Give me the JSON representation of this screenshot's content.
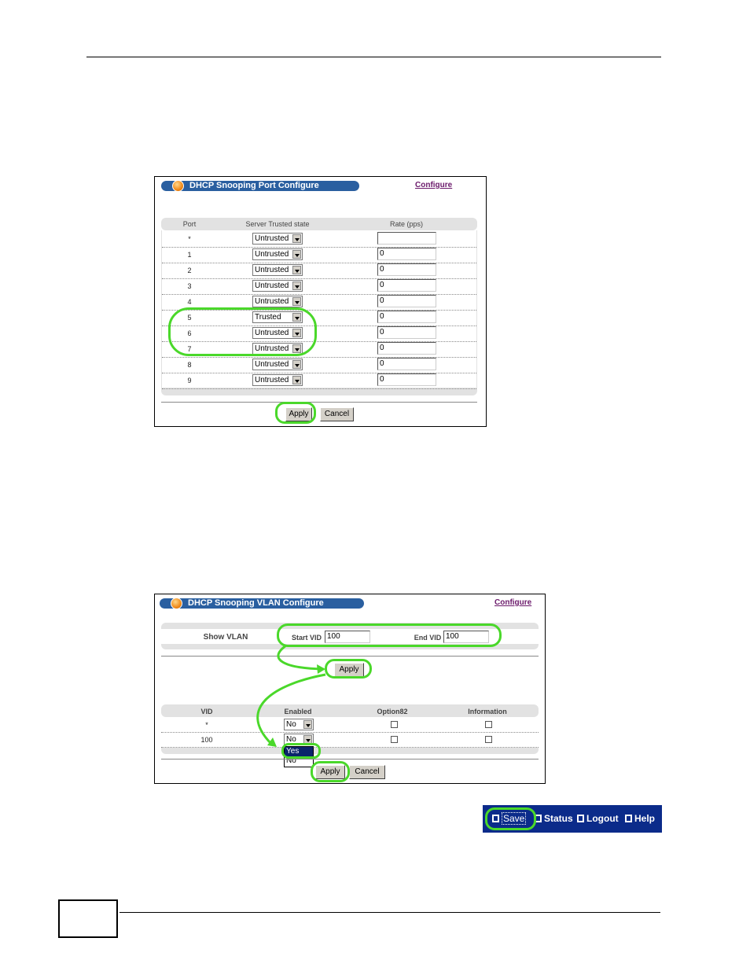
{
  "panel1": {
    "title": "DHCP Snooping Port Configure",
    "configure_link": "Configure",
    "headers": {
      "port": "Port",
      "state": "Server Trusted state",
      "rate": "Rate (pps)"
    },
    "rows": [
      {
        "port": "*",
        "state": "Untrusted",
        "rate": ""
      },
      {
        "port": "1",
        "state": "Untrusted",
        "rate": "0"
      },
      {
        "port": "2",
        "state": "Untrusted",
        "rate": "0"
      },
      {
        "port": "3",
        "state": "Untrusted",
        "rate": "0"
      },
      {
        "port": "4",
        "state": "Untrusted",
        "rate": "0"
      },
      {
        "port": "5",
        "state": "Trusted",
        "rate": "0"
      },
      {
        "port": "6",
        "state": "Untrusted",
        "rate": "0"
      },
      {
        "port": "7",
        "state": "Untrusted",
        "rate": "0"
      },
      {
        "port": "8",
        "state": "Untrusted",
        "rate": "0"
      },
      {
        "port": "9",
        "state": "Untrusted",
        "rate": "0"
      }
    ],
    "apply": "Apply",
    "cancel": "Cancel"
  },
  "panel2": {
    "title": "DHCP Snooping VLAN Configure",
    "configure_link": "Configure",
    "show_vlan": "Show VLAN",
    "start_vid_label": "Start VID",
    "start_vid_value": "100",
    "end_vid_label": "End VID",
    "end_vid_value": "100",
    "apply_top": "Apply",
    "headers": {
      "vid": "VID",
      "enabled": "Enabled",
      "option82": "Option82",
      "information": "Information"
    },
    "rows": [
      {
        "vid": "*",
        "enabled": "No",
        "option82": false,
        "information": false
      },
      {
        "vid": "100",
        "enabled": "No",
        "option82": false,
        "information": false
      }
    ],
    "dropdown_options": [
      "Yes",
      "No"
    ],
    "dropdown_selected": "Yes",
    "apply": "Apply",
    "cancel": "Cancel"
  },
  "toolbar": {
    "save": "Save",
    "status": "Status",
    "logout": "Logout",
    "help": "Help"
  },
  "colors": {
    "highlight": "#4ad82a",
    "title_bar": "#2a5fa0",
    "toolbar": "#0b2b8a"
  }
}
